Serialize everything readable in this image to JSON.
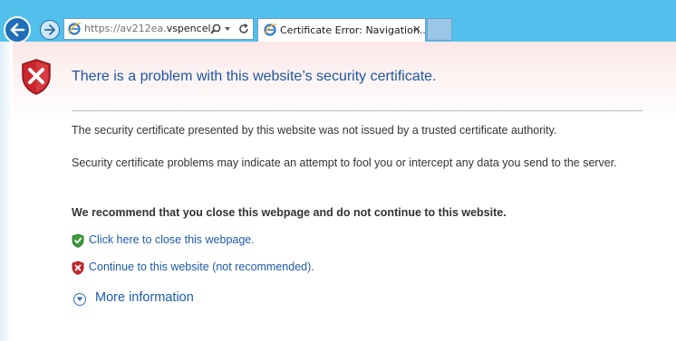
{
  "browser": {
    "address_bar": {
      "url_prefix": "https://av212ea.",
      "url_domain": "vspencel...",
      "search_icon": "search-icon",
      "dropdown_icon": "chevron-down-icon",
      "refresh_icon": "refresh-icon"
    },
    "tab": {
      "title": "Certificate Error: Navigation...",
      "close_label": "×"
    },
    "colors": {
      "chrome": "#52c0ec",
      "tab_border": "#6e9fca"
    }
  },
  "page": {
    "heading": "There is a problem with this website’s security certificate.",
    "paragraph1": "The security certificate presented by this website was not issued by a trusted certificate authority.",
    "paragraph2": "Security certificate problems may indicate an attempt to fool you or intercept any data you send to the server.",
    "recommendation": "We recommend that you close this webpage and do not continue to this website.",
    "close_link": "Click here to close this webpage.",
    "continue_link": "Continue to this website (not recommended).",
    "more_info": "More information",
    "colors": {
      "heading": "#1e56a0",
      "link": "#1d5aa8",
      "error": "#c8282d",
      "safe": "#3a9b3a"
    }
  }
}
